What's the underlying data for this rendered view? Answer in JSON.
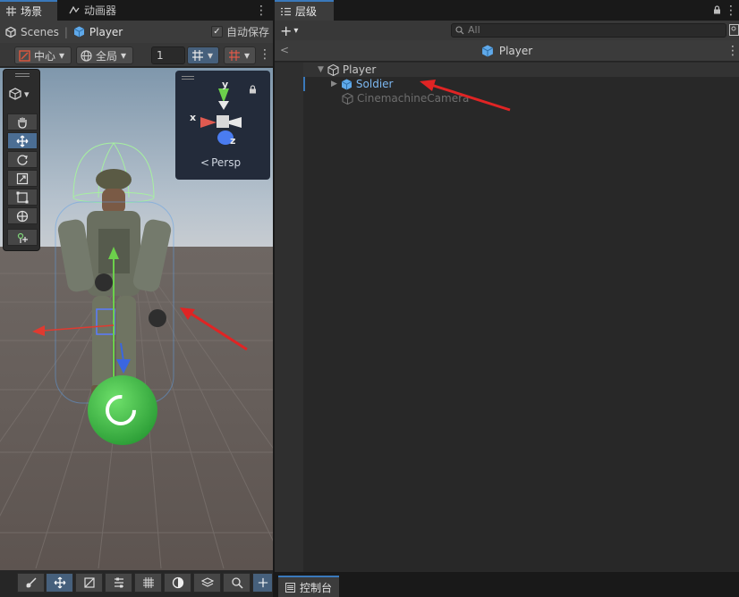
{
  "scene_panel": {
    "tabs": [
      {
        "label": "场景",
        "icon": "grid-icon",
        "active": true
      },
      {
        "label": "动画器",
        "icon": "animator-icon",
        "active": false
      }
    ],
    "breadcrumb": {
      "scenes": "Scenes",
      "prefab": "Player"
    },
    "autosave": {
      "label": "自动保存",
      "checked": true
    },
    "toolbar": {
      "pivot": "中心",
      "space": "全局",
      "grid_size": "1"
    },
    "gizmo": {
      "x": "x",
      "y": "y",
      "z": "z",
      "projection": "Persp"
    },
    "tools": [
      "hand-tool",
      "move-tool",
      "rotate-tool",
      "scale-tool",
      "rect-tool",
      "transform-tool",
      "custom-tool"
    ],
    "bottom_tools": [
      "scene-view-tool",
      "move-tool",
      "snap-tool",
      "align-tool",
      "grid-tool",
      "shading-tool",
      "layers-tool",
      "search-tool",
      "more-tool"
    ]
  },
  "hierarchy": {
    "tab": {
      "label": "层级",
      "icon": "list-icon"
    },
    "search_placeholder": "All",
    "context_title": "Player",
    "items": [
      {
        "label": "Player",
        "depth": 0,
        "expanded": true,
        "style": "normal"
      },
      {
        "label": "Soldier",
        "depth": 1,
        "expanded": false,
        "style": "prefab-blue"
      },
      {
        "label": "CinemachineCamera",
        "depth": 1,
        "expanded": false,
        "style": "disabled"
      }
    ]
  },
  "console": {
    "label": "控制台"
  },
  "colors": {
    "accent": "#3a79bb",
    "prefab_blue": "#7cb7f0",
    "annotation_red": "#e02424"
  }
}
